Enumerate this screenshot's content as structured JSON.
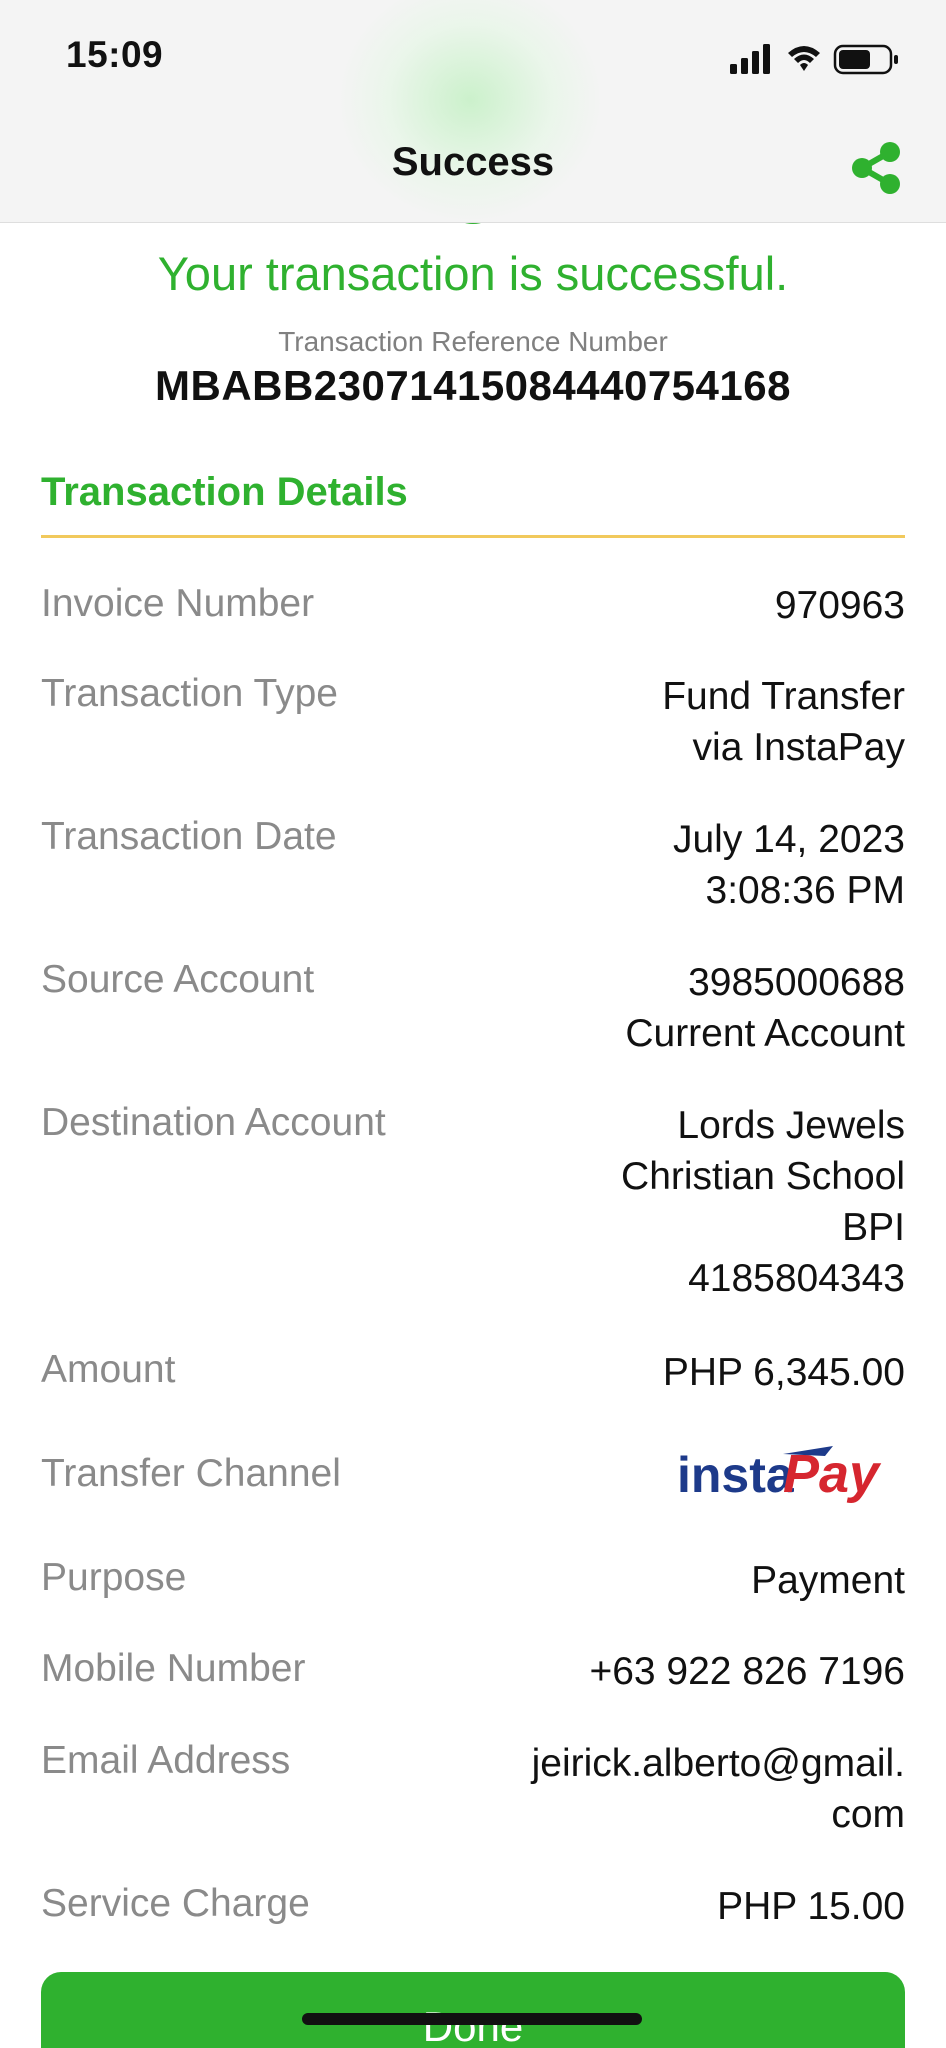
{
  "status_bar": {
    "time": "15:09"
  },
  "header": {
    "title": "Success"
  },
  "result": {
    "message": "Your transaction is successful.",
    "reference_label": "Transaction Reference Number",
    "reference_number": "MBABB230714150844407541​68"
  },
  "details": {
    "section_title": "Transaction Details",
    "invoice_number": {
      "label": "Invoice Number",
      "value": "970963"
    },
    "transaction_type": {
      "label": "Transaction Type",
      "line1": "Fund Transfer",
      "line2": "via InstaPay"
    },
    "transaction_date": {
      "label": "Transaction Date",
      "line1": "July 14, 2023",
      "line2": "3:08:36 PM"
    },
    "source_account": {
      "label": "Source Account",
      "line1": "3985000688",
      "line2": "Current Account"
    },
    "destination_account": {
      "label": "Destination Account",
      "line1": "Lords Jewels",
      "line2": "Christian School",
      "line3": "BPI",
      "line4": "4185804343"
    },
    "amount": {
      "label": "Amount",
      "value": "PHP 6,345.00"
    },
    "transfer_channel": {
      "label": "Transfer Channel",
      "logo_text_1": "insta",
      "logo_text_2": "Pay"
    },
    "purpose": {
      "label": "Purpose",
      "value": "Payment"
    },
    "mobile_number": {
      "label": "Mobile Number",
      "value": "+63 922 826 7196"
    },
    "email_address": {
      "label": "Email Address",
      "line1": "jeirick.alberto@gmail.",
      "line2": "com"
    },
    "service_charge": {
      "label": "Service Charge",
      "value": "PHP 15.00"
    }
  },
  "actions": {
    "done_label": "Done"
  },
  "colors": {
    "accent_green": "#2fb12f",
    "rule_yellow": "#f1c95c",
    "instapay_blue": "#1d3a8a",
    "instapay_red": "#d6262f"
  }
}
